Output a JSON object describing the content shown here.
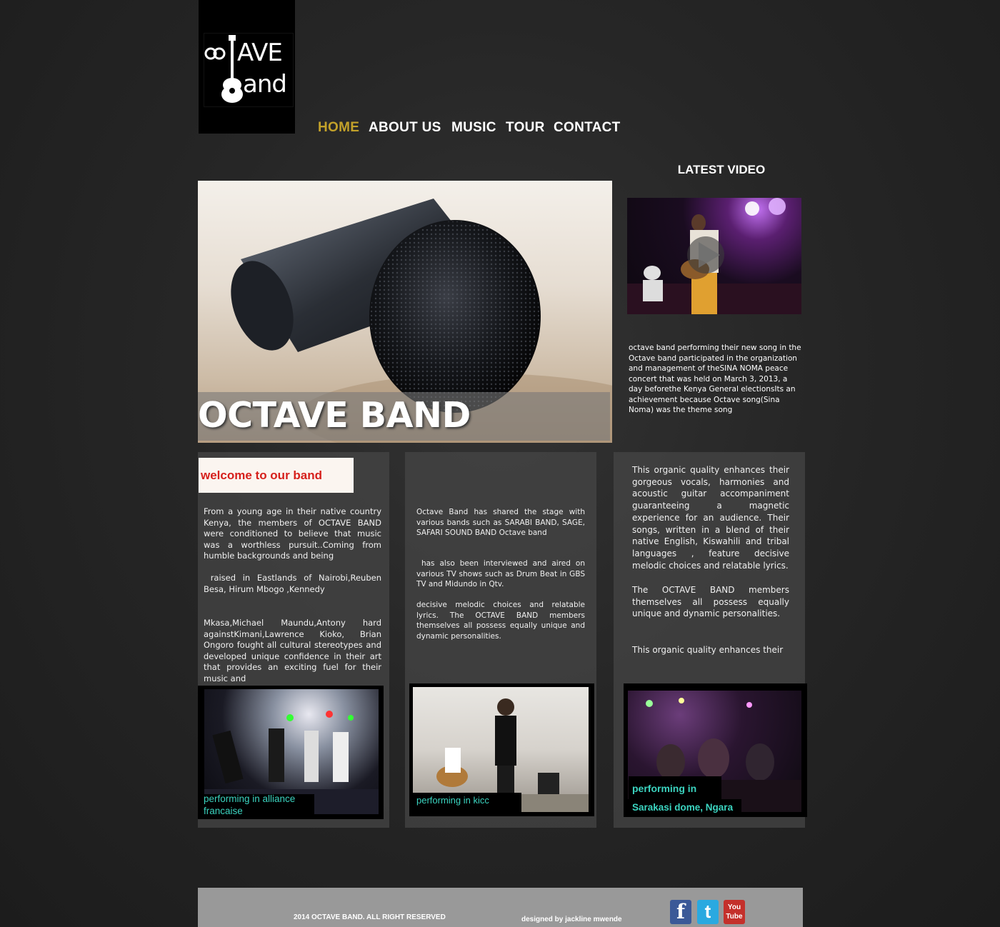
{
  "logo": {
    "line1": "AVE",
    "line2": "and"
  },
  "nav": [
    {
      "label": "HOME"
    },
    {
      "label": "ABOUT US"
    },
    {
      "label": "MUSIC"
    },
    {
      "label": "TOUR"
    },
    {
      "label": "CONTACT"
    }
  ],
  "hero": {
    "title": "OCTAVE BAND"
  },
  "latest_video": {
    "heading": "LATEST VIDEO",
    "description": "octave band performing their new song  in the Octave band participated in the organization and management of theSINA NOMA peace concert that was held on March 3, 2013, a day beforethe Kenya General electionsIts an achievement  because Octave song(Sina Noma) was the theme song"
  },
  "panels": [
    {
      "heading": "welcome to our band",
      "paragraphs": [
        "From a young age in their native country Kenya, the members of OCTAVE BAND were conditioned to believe that music was a worthless pursuit..Coming from humble backgrounds and being",
        " raised in Eastlands of Nairobi,Reuben Besa, Hirum Mbogo ,Kennedy",
        "Mkasa,Michael Maundu,Antony hard againstKimani,Lawrence Kioko, Brian Ongoro fought all cultural stereotypes and developed unique confidence in their art that provides an exciting fuel for their music and"
      ],
      "caption": "performing in alliance francaise"
    },
    {
      "paragraphs": [
        "Octave Band has shared the stage with various bands such as SARABI BAND, SAGE, SAFARI SOUND BAND Octave band",
        " has also been interviewed and aired on various TV shows such as Drum Beat in GBS TV and Midundo in Qtv.",
        "decisive melodic choices and relatable lyrics. The OCTAVE BAND members themselves all possess equally unique and dynamic personalities."
      ],
      "caption": "performing in kicc"
    },
    {
      "paragraphs": [
        "This organic quality enhances their gorgeous vocals, harmonies and acoustic guitar accompaniment guaranteeing a magnetic experience for an audience. Their songs, written in a blend of their native English, Kiswahili and tribal languages , feature decisive melodic choices and relatable lyrics.",
        "The OCTAVE BAND members themselves all possess equally unique and dynamic personalities.",
        "This organic quality enhances their"
      ],
      "caption_line1": "performing in",
      "caption_line2": "Sarakasi dome, Ngara"
    }
  ],
  "footer": {
    "copyright": "2014  OCTAVE BAND. ALL RIGHT RESERVED",
    "designed_by": "designed by jackline mwende",
    "social": [
      {
        "icon": "facebook-icon",
        "glyph": "f",
        "color": "#3b5998"
      },
      {
        "icon": "twitter-icon",
        "glyph": "t",
        "color": "#2aa9e0"
      },
      {
        "icon": "youtube-icon",
        "glyph": "You Tube",
        "color": "#c4302b"
      }
    ]
  },
  "colors": {
    "nav_active": "#c2a12a",
    "welcome_red": "#d6201c",
    "caption_teal": "#3bd4c0"
  }
}
